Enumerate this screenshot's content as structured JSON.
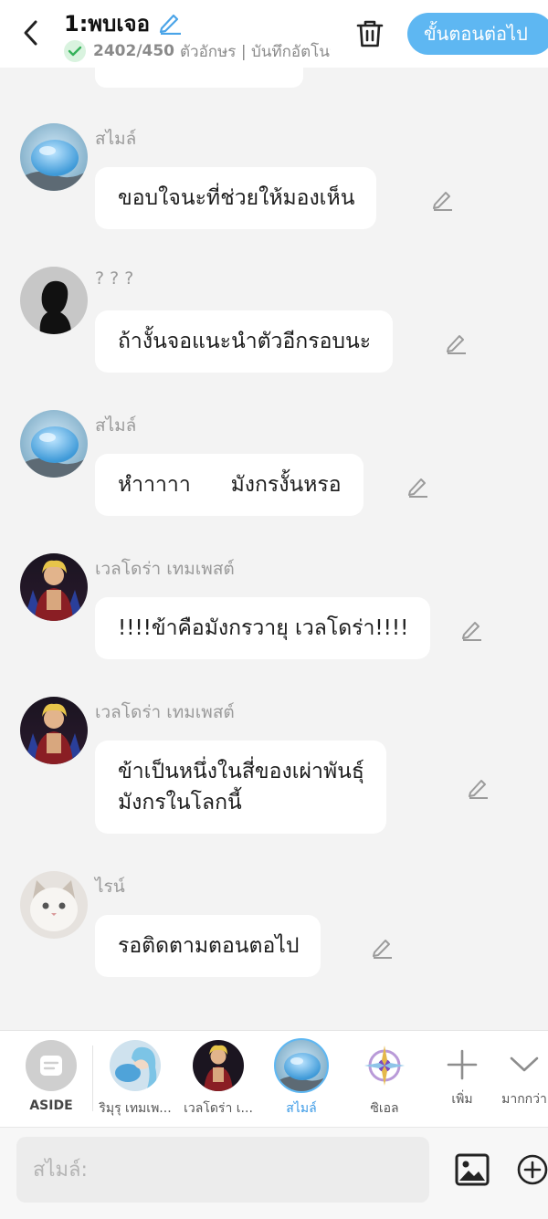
{
  "header": {
    "title": "1:พบเจอ",
    "char_count": "2402/450",
    "status_text": "ตัวอักษร | บันทึกอัตโนมัติ",
    "next_button": "ขั้นตอนต่อไป",
    "accent_color": "#5eb7f2"
  },
  "messages": [
    {
      "name": "สไมล์",
      "text": "ขอบใจนะที่ช่วยให้มองเห็น",
      "avatar_icon": "blue-slime-avatar"
    },
    {
      "name": "? ? ?",
      "text": "ถ้างั้นจอแนะนำตัวอีกรอบนะ",
      "avatar_icon": "silhouette-avatar"
    },
    {
      "name": "สไมล์",
      "text": "หำาาาา      มังกรงั้นหรอ",
      "avatar_icon": "blue-slime-avatar"
    },
    {
      "name": "เวลโดร่า เทมเพสต์",
      "text": "!!!!ข้าคือมังกรวายุ เวลโดร่า!!!!",
      "avatar_icon": "blond-warrior-avatar"
    },
    {
      "name": "เวลโดร่า เทมเพสต์",
      "text": "ข้าเป็นหนึ่งในสี่ของเผ่าพันธุ์\nมังกรในโลกนี้",
      "avatar_icon": "blond-warrior-avatar"
    },
    {
      "name": "ไรน์",
      "text": "รอติดตามตอนตอไป",
      "avatar_icon": "white-cat-avatar"
    }
  ],
  "character_bar": {
    "aside_label": "ASIDE",
    "characters": [
      {
        "label": "ริมุรุ เทมเพ...",
        "icon": "slime-girl-avatar"
      },
      {
        "label": "เวลโดร่า เ...",
        "icon": "blond-warrior-avatar"
      },
      {
        "label": "สไมล์",
        "icon": "blue-slime-avatar"
      },
      {
        "label": "ซิเอล",
        "icon": "purple-emblem-avatar"
      }
    ],
    "add_label": "เพิ่ม",
    "more_label": "มากกว่า"
  },
  "input": {
    "placeholder": "สไมล์:"
  }
}
